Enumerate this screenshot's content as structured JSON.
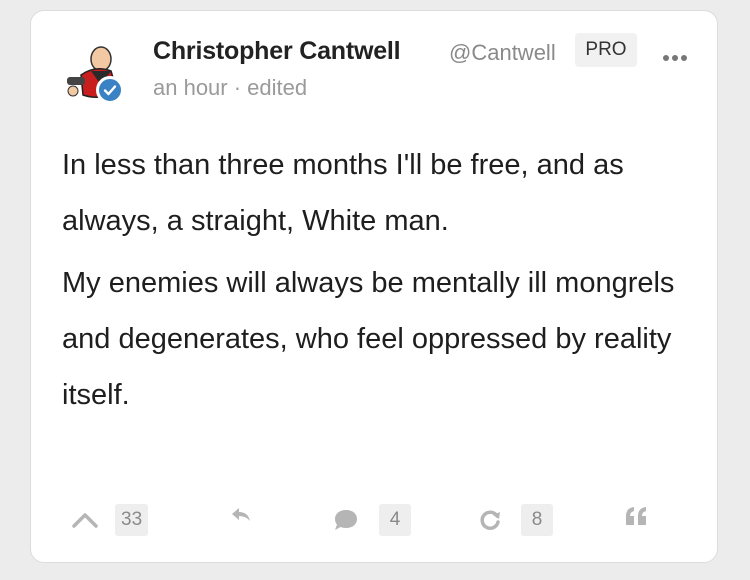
{
  "post": {
    "author_name": "Christopher Cantwell",
    "author_handle": "@Cantwell",
    "badge": "PRO",
    "meta": "an hour · edited",
    "paragraphs": [
      "In less than three months I'll be free, and as always, a straight, White man.",
      "My enemies will always be mentally ill mongrels and degenerates, who feel oppressed by reality itself."
    ]
  },
  "actions": {
    "upvote_count": "33",
    "comment_count": "4",
    "repost_count": "8"
  },
  "colors": {
    "verified": "#3b82c4",
    "muted_text": "#9a9a9a",
    "count_bg": "#eeeeee"
  },
  "icons": [
    "avatar",
    "verified-icon",
    "more-options-icon",
    "upvote-icon",
    "reply-icon",
    "comment-icon",
    "repost-icon",
    "quote-icon"
  ]
}
